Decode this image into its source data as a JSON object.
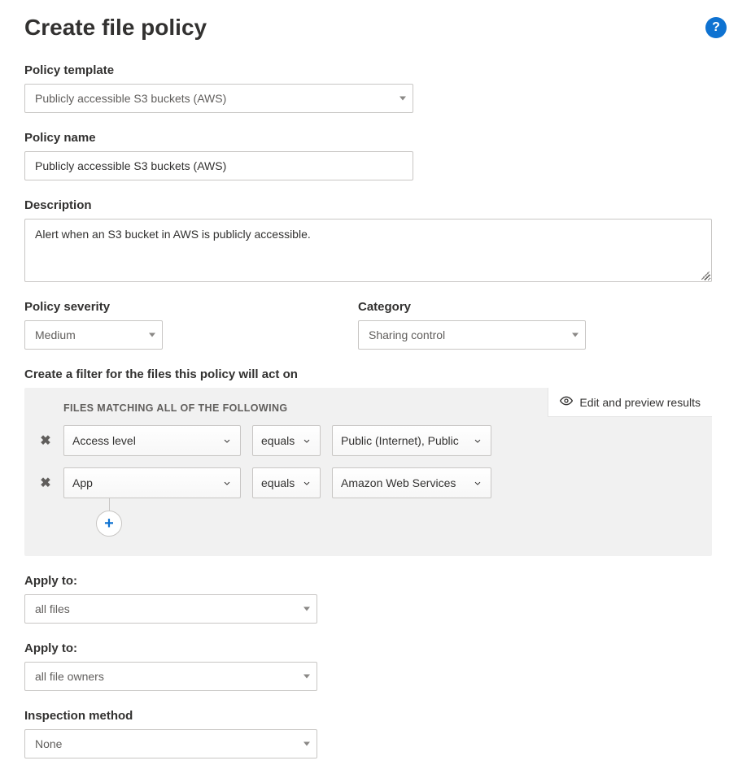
{
  "header": {
    "title": "Create file policy"
  },
  "help_tooltip": "?",
  "template": {
    "label": "Policy template",
    "value": "Publicly accessible S3 buckets (AWS)"
  },
  "name": {
    "label": "Policy name",
    "value": "Publicly accessible S3 buckets (AWS)"
  },
  "description": {
    "label": "Description",
    "value": "Alert when an S3 bucket in AWS is publicly accessible."
  },
  "severity": {
    "label": "Policy severity",
    "value": "Medium"
  },
  "category": {
    "label": "Category",
    "value": "Sharing control"
  },
  "filter_heading": "Create a filter for the files this policy will act on",
  "preview_label": "Edit and preview results",
  "files_matching_heading": "FILES MATCHING ALL OF THE FOLLOWING",
  "filters": [
    {
      "field": "Access level",
      "op": "equals",
      "value": "Public (Internet), Public"
    },
    {
      "field": "App",
      "op": "equals",
      "value": "Amazon Web Services"
    }
  ],
  "apply_files": {
    "label": "Apply to:",
    "value": "all files"
  },
  "apply_owners": {
    "label": "Apply to:",
    "value": "all file owners"
  },
  "inspection": {
    "label": "Inspection method",
    "value": "None"
  }
}
